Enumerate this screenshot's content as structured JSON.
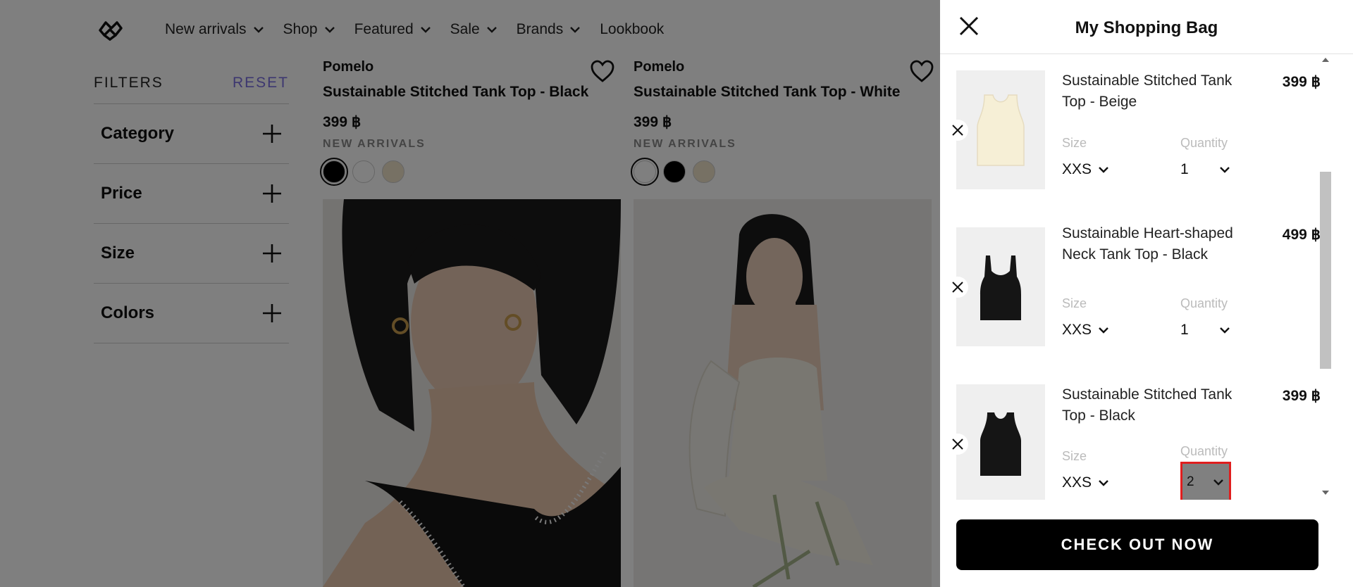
{
  "nav": {
    "logo_icon": "pomelo-logo-icon",
    "items": [
      {
        "label": "New arrivals",
        "has_dropdown": true
      },
      {
        "label": "Shop",
        "has_dropdown": true
      },
      {
        "label": "Featured",
        "has_dropdown": true
      },
      {
        "label": "Sale",
        "has_dropdown": true
      },
      {
        "label": "Brands",
        "has_dropdown": true
      },
      {
        "label": "Lookbook",
        "has_dropdown": false
      }
    ]
  },
  "filters": {
    "title": "FILTERS",
    "reset": "RESET",
    "groups": [
      {
        "label": "Category"
      },
      {
        "label": "Price"
      },
      {
        "label": "Size"
      },
      {
        "label": "Colors"
      }
    ]
  },
  "products": [
    {
      "brand": "Pomelo",
      "name": "Sustainable Stitched Tank Top - Black",
      "price": "399 ฿",
      "tag": "NEW ARRIVALS",
      "swatches": [
        "#000000",
        "#ffffff",
        "#efe3c8"
      ],
      "selected_swatch": 0
    },
    {
      "brand": "Pomelo",
      "name": "Sustainable Stitched Tank Top - White",
      "price": "399 ฿",
      "tag": "NEW ARRIVALS",
      "swatches": [
        "#ffffff",
        "#000000",
        "#efe3c8"
      ],
      "selected_swatch": 0
    }
  ],
  "bag": {
    "title": "My Shopping Bag",
    "size_label": "Size",
    "quantity_label": "Quantity",
    "items": [
      {
        "name": "Sustainable Stitched Tank Top - Beige",
        "price": "399 ฿",
        "size": "XXS",
        "quantity": "1",
        "color": "#f6efd6"
      },
      {
        "name": "Sustainable Heart-shaped Neck Tank Top - Black",
        "price": "499 ฿",
        "size": "XXS",
        "quantity": "1",
        "color": "#111111"
      },
      {
        "name": "Sustainable Stitched Tank Top - Black",
        "price": "399 ฿",
        "size": "XXS",
        "quantity": "2",
        "color": "#111111"
      }
    ],
    "checkout_label": "CHECK OUT NOW"
  },
  "colors": {
    "overlay": "rgba(0,0,0,0.5)",
    "reset_accent": "#7a6ee0",
    "focus_outline": "#e01e1e"
  }
}
